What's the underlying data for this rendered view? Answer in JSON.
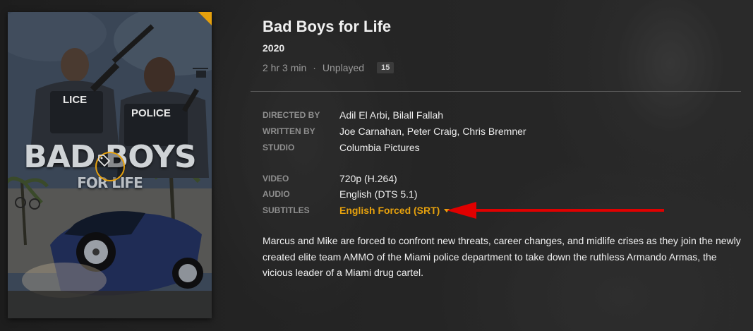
{
  "movie": {
    "title": "Bad Boys for Life",
    "year": "2020",
    "duration": "2 hr 3 min",
    "separator": "·",
    "play_status": "Unplayed",
    "badge_count": "15",
    "poster": {
      "title_line1": "BAD BOYS",
      "title_line2": "FOR LIFE",
      "vest_text_left": "LICE",
      "vest_text_right": "POLICE",
      "corner_color": "#e5a00d",
      "tag_icon": "tag-icon"
    }
  },
  "credits": [
    {
      "label": "Directed by",
      "value": "Adil El Arbi, Bilall Fallah"
    },
    {
      "label": "Written by",
      "value": "Joe Carnahan, Peter Craig, Chris Bremner"
    },
    {
      "label": "Studio",
      "value": "Columbia Pictures"
    }
  ],
  "media": [
    {
      "label": "Video",
      "value": "720p (H.264)"
    },
    {
      "label": "Audio",
      "value": "English (DTS 5.1)"
    },
    {
      "label": "Subtitles",
      "value": "English Forced (SRT)",
      "dropdown": true
    }
  ],
  "summary": "Marcus and Mike are forced to confront new threats, career changes, and midlife crises as they join the newly created elite team AMMO of the Miami police department to take down the ruthless Armando Armas, the vicious leader of a Miami drug cartel.",
  "colors": {
    "accent": "#e5a00d",
    "annotation_arrow": "#e00000"
  }
}
